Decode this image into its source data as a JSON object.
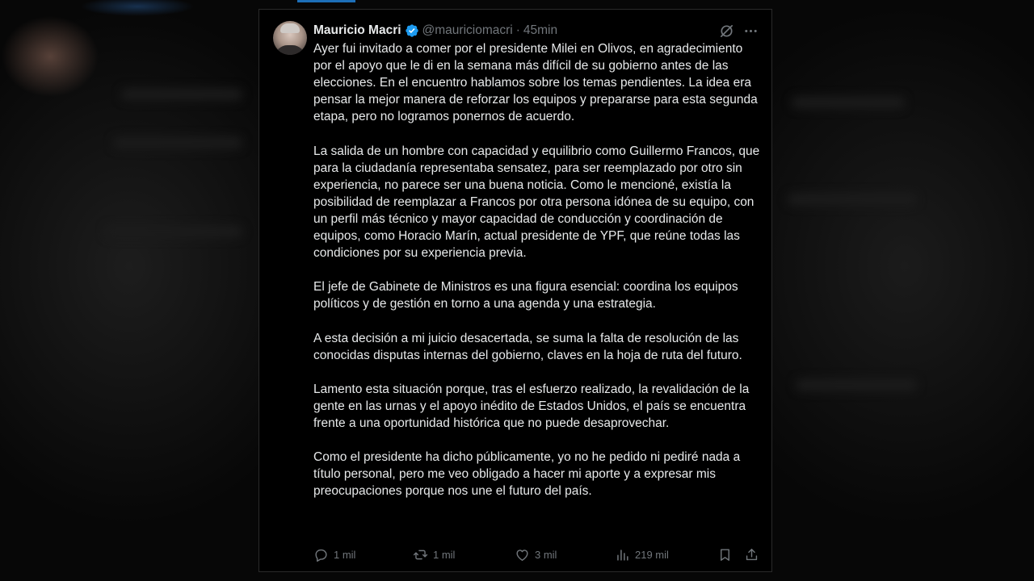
{
  "tweet": {
    "author_name": "Mauricio Macri",
    "handle": "@mauriciomacri",
    "separator": "·",
    "time": "45min",
    "paragraphs": [
      "Ayer fui invitado a comer por el presidente Milei en Olivos, en agradecimiento por el apoyo que le di en la semana más difícil de su gobierno antes de las elecciones. En el encuentro hablamos sobre los temas pendientes. La idea era pensar la mejor manera de reforzar los equipos y prepararse para esta segunda etapa, pero no logramos ponernos de acuerdo.",
      "La salida de un hombre con capacidad y equilibrio como Guillermo Francos, que para la ciudadanía representaba sensatez, para ser reemplazado por otro sin experiencia, no parece ser una buena noticia. Como le mencioné, existía la posibilidad de reemplazar a Francos por otra persona idónea de su equipo, con un perfil más técnico y mayor capacidad de conducción y coordinación de equipos, como Horacio Marín, actual presidente de YPF, que reúne todas las condiciones por su experiencia previa.",
      "El jefe de Gabinete de Ministros es una figura esencial: coordina los equipos políticos y de gestión en torno a una agenda y una estrategia.",
      "A esta decisión a mi juicio desacertada, se suma la falta de resolución de las conocidas disputas internas del gobierno, claves en la hoja de ruta del futuro.",
      "Lamento esta situación porque, tras el esfuerzo realizado, la revalidación de la gente en las urnas y el apoyo inédito de Estados Unidos, el país se encuentra frente a una oportunidad histórica que no puede desaprovechar.",
      "Como el presidente ha dicho públicamente, yo no he pedido ni pediré nada a título personal, pero me veo obligado a hacer mi aporte y a expresar mis preocupaciones porque nos une el futuro del país."
    ],
    "stats": {
      "replies": "1 mil",
      "reposts": "1 mil",
      "likes": "3 mil",
      "views": "219 mil"
    }
  },
  "icons": {
    "verified": "verified-badge-icon",
    "grok": "grok-icon",
    "more": "more-icon",
    "reply": "reply-icon",
    "repost": "repost-icon",
    "like": "like-icon",
    "views": "views-icon",
    "bookmark": "bookmark-icon",
    "share": "share-icon"
  },
  "colors": {
    "background": "#000000",
    "text": "#e7e9ea",
    "secondary": "#71767b",
    "verified": "#1d9bf0"
  }
}
